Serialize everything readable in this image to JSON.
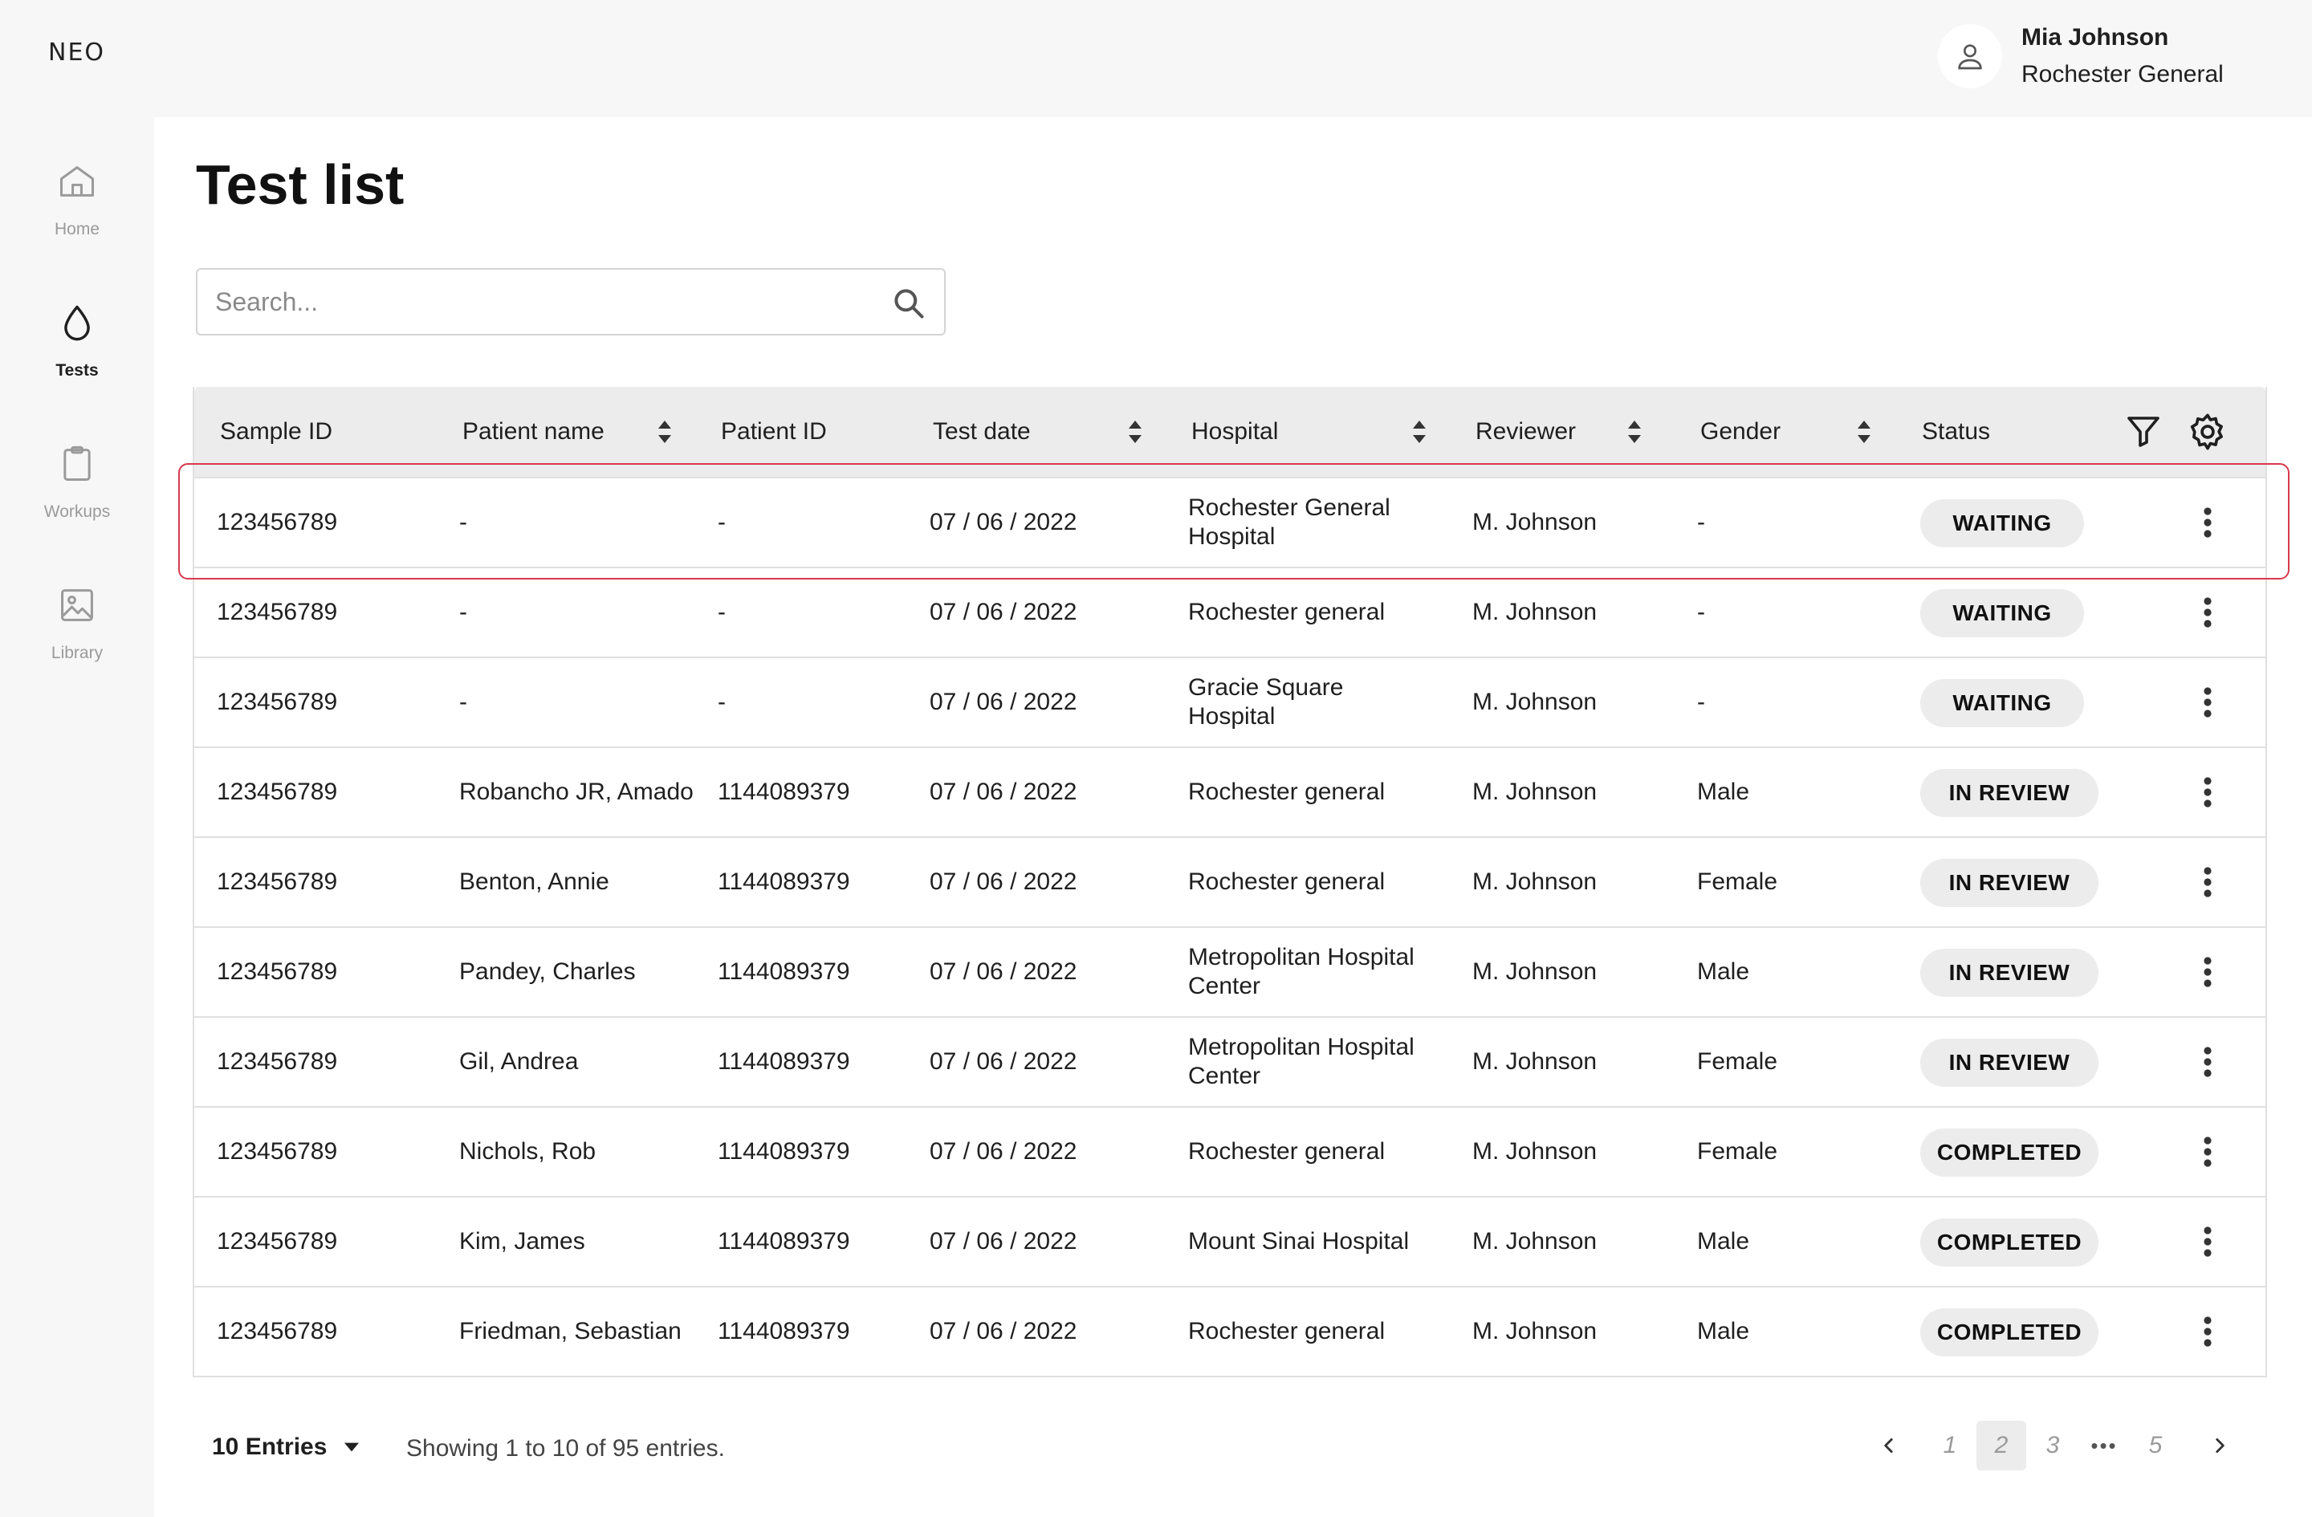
{
  "app": {
    "logo": "NEO"
  },
  "user": {
    "name": "Mia Johnson",
    "organization": "Rochester General"
  },
  "sidebar": {
    "items": [
      {
        "label": "Home",
        "icon": "home-icon",
        "active": false
      },
      {
        "label": "Tests",
        "icon": "drop-icon",
        "active": true
      },
      {
        "label": "Workups",
        "icon": "clipboard-icon",
        "active": false
      },
      {
        "label": "Library",
        "icon": "image-icon",
        "active": false
      }
    ]
  },
  "page": {
    "title": "Test list"
  },
  "search": {
    "placeholder": "Search..."
  },
  "table": {
    "columns": [
      "Sample ID",
      "Patient name",
      "Patient ID",
      "Test date",
      "Hospital",
      "Reviewer",
      "Gender",
      "Status"
    ],
    "sortable": [
      false,
      true,
      false,
      true,
      true,
      true,
      true,
      false
    ],
    "rows": [
      {
        "sample_id": "123456789",
        "patient_name": "-",
        "patient_id": "-",
        "test_date": "07 / 06 / 2022",
        "hospital": "Rochester General Hospital",
        "reviewer": "M. Johnson",
        "gender": "-",
        "status": "WAITING",
        "highlighted": true
      },
      {
        "sample_id": "123456789",
        "patient_name": "-",
        "patient_id": "-",
        "test_date": "07 / 06 / 2022",
        "hospital": "Rochester general",
        "reviewer": "M. Johnson",
        "gender": "-",
        "status": "WAITING"
      },
      {
        "sample_id": "123456789",
        "patient_name": "-",
        "patient_id": "-",
        "test_date": "07 / 06 / 2022",
        "hospital": "Gracie Square Hospital",
        "reviewer": "M. Johnson",
        "gender": "-",
        "status": "WAITING"
      },
      {
        "sample_id": "123456789",
        "patient_name": "Robancho JR, Amado",
        "patient_id": "1144089379",
        "test_date": "07 / 06 / 2022",
        "hospital": "Rochester general",
        "reviewer": "M. Johnson",
        "gender": "Male",
        "status": "IN REVIEW"
      },
      {
        "sample_id": "123456789",
        "patient_name": "Benton, Annie",
        "patient_id": "1144089379",
        "test_date": "07 / 06 / 2022",
        "hospital": "Rochester general",
        "reviewer": "M. Johnson",
        "gender": "Female",
        "status": "IN REVIEW"
      },
      {
        "sample_id": "123456789",
        "patient_name": "Pandey, Charles",
        "patient_id": "1144089379",
        "test_date": "07 / 06 / 2022",
        "hospital": "Metropolitan Hospital Center",
        "reviewer": "M. Johnson",
        "gender": "Male",
        "status": "IN REVIEW"
      },
      {
        "sample_id": "123456789",
        "patient_name": "Gil, Andrea",
        "patient_id": "1144089379",
        "test_date": "07 / 06 / 2022",
        "hospital": "Metropolitan Hospital Center",
        "reviewer": "M. Johnson",
        "gender": "Female",
        "status": "IN REVIEW"
      },
      {
        "sample_id": "123456789",
        "patient_name": "Nichols, Rob",
        "patient_id": "1144089379",
        "test_date": "07 / 06 / 2022",
        "hospital": "Rochester general",
        "reviewer": "M. Johnson",
        "gender": "Female",
        "status": "COMPLETED"
      },
      {
        "sample_id": "123456789",
        "patient_name": "Kim, James",
        "patient_id": "1144089379",
        "test_date": "07 / 06 / 2022",
        "hospital": "Mount Sinai Hospital",
        "reviewer": "M. Johnson",
        "gender": "Male",
        "status": "COMPLETED"
      },
      {
        "sample_id": "123456789",
        "patient_name": "Friedman, Sebastian",
        "patient_id": "1144089379",
        "test_date": "07 / 06 / 2022",
        "hospital": "Rochester general",
        "reviewer": "M. Johnson",
        "gender": "Male",
        "status": "COMPLETED"
      }
    ]
  },
  "footer": {
    "entries_label": "10 Entries",
    "showing_text": "Showing 1 to 10 of 95 entries.",
    "pages": [
      "1",
      "2",
      "3",
      "5"
    ],
    "current_page": "2",
    "ellipsis": "•••"
  },
  "colors": {
    "highlight_border": "#d8394d",
    "badge_bg": "#ececec",
    "header_bg": "#ececec"
  }
}
